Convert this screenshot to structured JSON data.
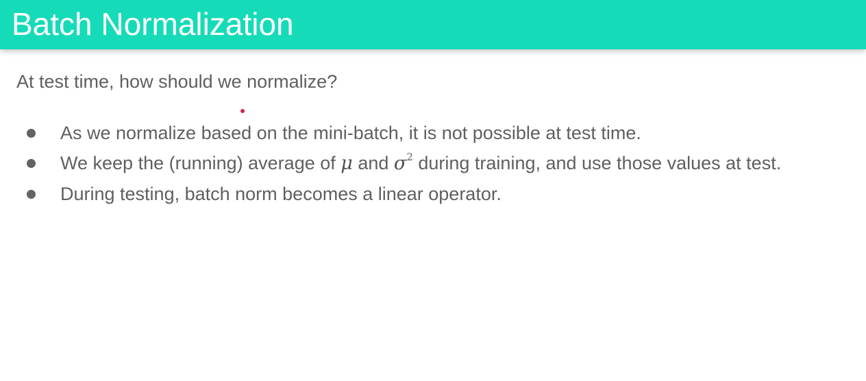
{
  "slide": {
    "title": "Batch Normalization",
    "intro": "At test time, how should we normalize?",
    "bullets": {
      "item1": "As we normalize based on the mini-batch, it is not possible at test time.",
      "item2_part1": "We keep the (running) average of ",
      "item2_mu": "μ",
      "item2_part2": " and ",
      "item2_sigma": "σ",
      "item2_exp": "2",
      "item2_part3": " during training, and use those values at test.",
      "item3": "During testing, batch norm becomes a linear operator."
    }
  },
  "colors": {
    "header_bg": "#16dbb8",
    "header_text": "#ffffff",
    "body_text": "#5f5f5f",
    "pointer_dot": "#d2234f"
  }
}
